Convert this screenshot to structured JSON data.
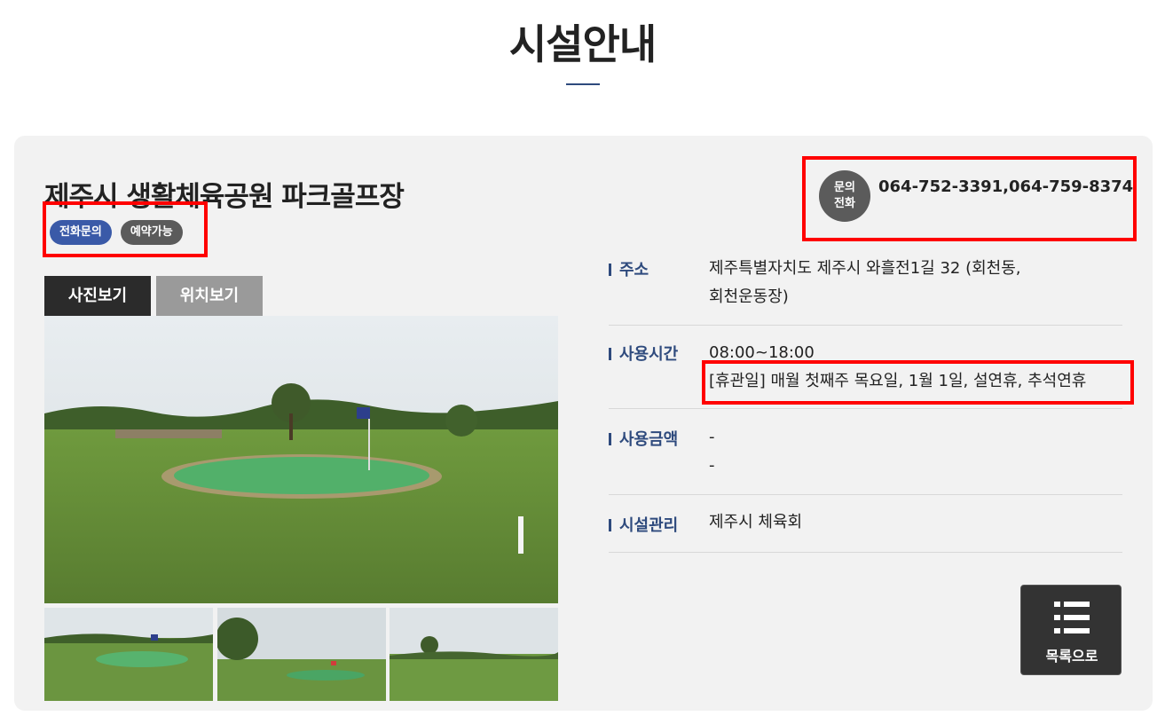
{
  "page": {
    "title": "시설안내"
  },
  "facility": {
    "name": "제주시 생활체육공원 파크골프장",
    "badges": [
      "전화문의",
      "예약가능"
    ],
    "contact": {
      "label_line1": "문의",
      "label_line2": "전화",
      "number": "064-752-3391,064-759-8374"
    }
  },
  "tabs": {
    "photos": "사진보기",
    "location": "위치보기"
  },
  "info": {
    "address_label": "주소",
    "address_line1": "제주특별자치도 제주시 와흘전1길 32 (회천동,",
    "address_line2": "회천운동장)",
    "hours_label": "사용시간",
    "hours_value": "08:00~18:00",
    "hours_closed": "[휴관일] 매월 첫째주 목요일, 1월 1일, 설연휴, 추석연휴",
    "fee_label": "사용금액",
    "fee_line1": "-",
    "fee_line2": "-",
    "manager_label": "시설관리",
    "manager_value": "제주시 체육회"
  },
  "list_button": {
    "label": "목록으로",
    "icon": "list-icon"
  },
  "colors": {
    "accent": "#2e4a7d",
    "badge_blue": "#3a5aa8",
    "highlight": "#ff0000"
  }
}
